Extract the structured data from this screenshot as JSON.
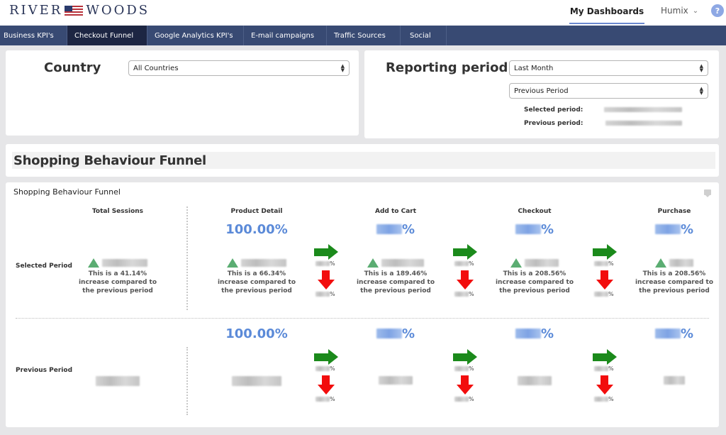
{
  "header": {
    "logo_left": "RIVER",
    "logo_right": "WOODS",
    "logo_icon": "us-flag-icon",
    "my_dashboards": "My Dashboards",
    "user_name": "Humix",
    "user_chevron": "⌄",
    "help_label": "?"
  },
  "nav": {
    "tabs": [
      {
        "label": "Business KPI's",
        "active": false
      },
      {
        "label": "Checkout Funnel",
        "active": true
      },
      {
        "label": "Google Analytics KPI's",
        "active": false
      },
      {
        "label": "E-mail campaigns",
        "active": false
      },
      {
        "label": "Traffic Sources",
        "active": false
      },
      {
        "label": "Social",
        "active": false
      }
    ]
  },
  "filters": {
    "country": {
      "title": "Country",
      "selected": "All Countries"
    },
    "reporting": {
      "title": "Reporting period",
      "period_selected": "Last Month",
      "comparison_selected": "Previous Period",
      "selected_period_label": "Selected period:",
      "previous_period_label": "Previous period:",
      "selected_period_value": "[redacted]",
      "previous_period_value": "[redacted]"
    }
  },
  "section": {
    "heading": "Shopping Behaviour Funnel"
  },
  "funnel": {
    "title": "Shopping Behaviour Funnel",
    "row_labels": {
      "selected": "Selected Period",
      "previous": "Previous Period"
    },
    "columns": [
      {
        "name": "Total Sessions",
        "selected": {
          "rate": null,
          "count": "[redacted]",
          "trend": "up",
          "change_text": "This is a 41.14% increase compared to the previous period",
          "change_pct": "41.14%"
        },
        "previous": {
          "rate": null,
          "count": "[redacted]"
        }
      },
      {
        "name": "Product Detail",
        "selected": {
          "rate": "100.00%",
          "count": "[redacted]",
          "trend": "up",
          "change_text": "This is a 66.34% increase compared to the previous period",
          "change_pct": "66.34%"
        },
        "previous": {
          "rate": "100.00%",
          "count": "[redacted]"
        }
      },
      {
        "name": "Add to Cart",
        "selected": {
          "rate": "[redacted]%",
          "count": "[redacted]",
          "trend": "up",
          "change_text": "This is a 189.46% increase compared to the previous period",
          "change_pct": "189.46%"
        },
        "previous": {
          "rate": "[redacted]%",
          "count": "[redacted]"
        }
      },
      {
        "name": "Checkout",
        "selected": {
          "rate": "[redacted]%",
          "count": "[redacted]",
          "trend": "up",
          "change_text": "This is a 208.56% increase compared to the previous period",
          "change_pct": "208.56%"
        },
        "previous": {
          "rate": "[redacted]%",
          "count": "[redacted]"
        }
      },
      {
        "name": "Purchase",
        "selected": {
          "rate": "[redacted]%",
          "count": "[redacted]",
          "trend": "up",
          "change_text": "This is a 208.56% increase compared to the previous period",
          "change_pct": "208.56%"
        },
        "previous": {
          "rate": "[redacted]%",
          "count": "[redacted]"
        }
      }
    ],
    "transitions": {
      "continue_icon": "green-right-arrow-icon",
      "dropoff_icon": "red-down-arrow-icon",
      "pct_suffix": "%",
      "continue_pct": "[redacted]",
      "dropoff_pct": "[redacted]"
    },
    "colors": {
      "rate_blue": "#5b8ad8",
      "up_green": "#5bad72",
      "continue_green": "#1b8a1b",
      "dropoff_red": "#f20d0d",
      "nav_bg": "#384a73",
      "nav_active": "#1d2643"
    }
  }
}
